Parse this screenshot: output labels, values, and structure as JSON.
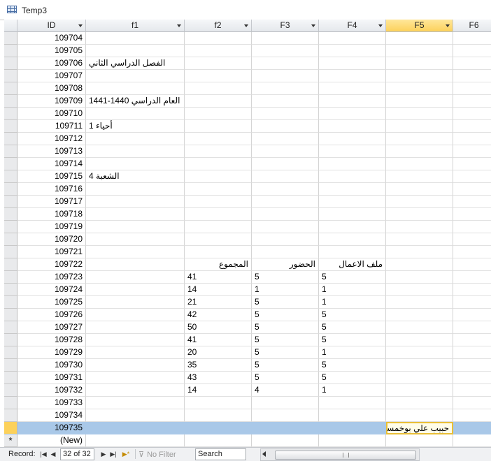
{
  "window": {
    "title": "Temp3"
  },
  "columns": [
    "ID",
    "f1",
    "f2",
    "F3",
    "F4",
    "F5",
    "F6"
  ],
  "rows": [
    {
      "id": "109704",
      "f1": "",
      "f2": "",
      "f3": "",
      "f4": "",
      "f5": ""
    },
    {
      "id": "109705",
      "f1": "",
      "f2": "",
      "f3": "",
      "f4": "",
      "f5": ""
    },
    {
      "id": "109706",
      "f1": "الفصل الدراسي الثاني",
      "f2": "",
      "f3": "",
      "f4": "",
      "f5": ""
    },
    {
      "id": "109707",
      "f1": "",
      "f2": "",
      "f3": "",
      "f4": "",
      "f5": ""
    },
    {
      "id": "109708",
      "f1": "",
      "f2": "",
      "f3": "",
      "f4": "",
      "f5": ""
    },
    {
      "id": "109709",
      "f1": "العام الدراسي 1440-1441",
      "f2": "",
      "f3": "",
      "f4": "",
      "f5": ""
    },
    {
      "id": "109710",
      "f1": "",
      "f2": "",
      "f3": "",
      "f4": "",
      "f5": ""
    },
    {
      "id": "109711",
      "f1": "أحياء 1",
      "f2": "",
      "f3": "",
      "f4": "",
      "f5": ""
    },
    {
      "id": "109712",
      "f1": "",
      "f2": "",
      "f3": "",
      "f4": "",
      "f5": ""
    },
    {
      "id": "109713",
      "f1": "",
      "f2": "",
      "f3": "",
      "f4": "",
      "f5": ""
    },
    {
      "id": "109714",
      "f1": "",
      "f2": "",
      "f3": "",
      "f4": "",
      "f5": ""
    },
    {
      "id": "109715",
      "f1": "الشعبة 4",
      "f2": "",
      "f3": "",
      "f4": "",
      "f5": ""
    },
    {
      "id": "109716",
      "f1": "",
      "f2": "",
      "f3": "",
      "f4": "",
      "f5": ""
    },
    {
      "id": "109717",
      "f1": "",
      "f2": "",
      "f3": "",
      "f4": "",
      "f5": ""
    },
    {
      "id": "109718",
      "f1": "",
      "f2": "",
      "f3": "",
      "f4": "",
      "f5": ""
    },
    {
      "id": "109719",
      "f1": "",
      "f2": "",
      "f3": "",
      "f4": "",
      "f5": ""
    },
    {
      "id": "109720",
      "f1": "",
      "f2": "",
      "f3": "",
      "f4": "",
      "f5": ""
    },
    {
      "id": "109721",
      "f1": "",
      "f2": "",
      "f3": "",
      "f4": "",
      "f5": ""
    },
    {
      "id": "109722",
      "f1": "",
      "f2": "المجموع",
      "f3": "الحضور",
      "f4": "ملف الاعمال",
      "f5": ""
    },
    {
      "id": "109723",
      "f1": "",
      "f2": "41",
      "f3": "5",
      "f4": "5",
      "f5": ""
    },
    {
      "id": "109724",
      "f1": "",
      "f2": "14",
      "f3": "1",
      "f4": "1",
      "f5": ""
    },
    {
      "id": "109725",
      "f1": "",
      "f2": "21",
      "f3": "5",
      "f4": "1",
      "f5": ""
    },
    {
      "id": "109726",
      "f1": "",
      "f2": "42",
      "f3": "5",
      "f4": "5",
      "f5": ""
    },
    {
      "id": "109727",
      "f1": "",
      "f2": "50",
      "f3": "5",
      "f4": "5",
      "f5": ""
    },
    {
      "id": "109728",
      "f1": "",
      "f2": "41",
      "f3": "5",
      "f4": "5",
      "f5": ""
    },
    {
      "id": "109729",
      "f1": "",
      "f2": "20",
      "f3": "5",
      "f4": "1",
      "f5": ""
    },
    {
      "id": "109730",
      "f1": "",
      "f2": "35",
      "f3": "5",
      "f4": "5",
      "f5": ""
    },
    {
      "id": "109731",
      "f1": "",
      "f2": "43",
      "f3": "5",
      "f4": "5",
      "f5": ""
    },
    {
      "id": "109732",
      "f1": "",
      "f2": "14",
      "f3": "4",
      "f4": "1",
      "f5": ""
    },
    {
      "id": "109733",
      "f1": "",
      "f2": "",
      "f3": "",
      "f4": "",
      "f5": ""
    },
    {
      "id": "109734",
      "f1": "",
      "f2": "",
      "f3": "",
      "f4": "",
      "f5": ""
    },
    {
      "id": "109735",
      "f1": "",
      "f2": "",
      "f3": "",
      "f4": "",
      "f5": "حبيب علي بوخمسين"
    }
  ],
  "selected_row_index": 31,
  "new_row": {
    "marker": "*",
    "label": "(New)"
  },
  "statusbar": {
    "record_label": "Record:",
    "record_position": "32 of 32",
    "filter_label": "No Filter",
    "search_placeholder": "Search"
  },
  "colors": {
    "selected_row": "#a9c8e8",
    "active_header": "#fcd15b",
    "focus_border": "#e9bf37"
  }
}
